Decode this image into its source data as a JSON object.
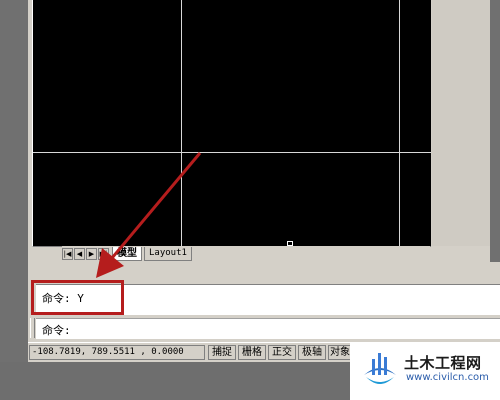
{
  "tabs": {
    "nav_first": "|◀",
    "nav_prev": "◀",
    "nav_next": "▶",
    "nav_last": "▶|",
    "model": "模型",
    "layout1": "Layout1"
  },
  "command": {
    "history_text": "命令: Y",
    "prompt_text": "命令:"
  },
  "status": {
    "coordinates": "-108.7819, 789.5511 , 0.0000",
    "snap": "捕捉",
    "grid": "栅格",
    "ortho": "正交",
    "polar": "极轴",
    "osnap": "对象"
  },
  "watermark": {
    "title": "土木工程网",
    "url": "www.civilcn.com"
  },
  "colors": {
    "highlight": "#b51d1d",
    "canvas": "#000000",
    "gridline": "#d8d8d8"
  }
}
